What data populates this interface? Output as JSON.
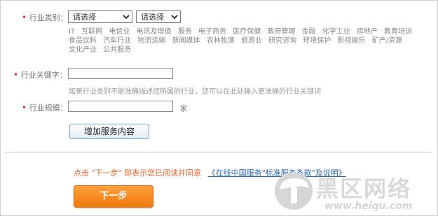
{
  "form": {
    "industry_category": {
      "required_mark": "•",
      "label": "行业类别：",
      "select1_value": "请选择",
      "select2_value": "请选择"
    },
    "industries": [
      "IT",
      "互联网",
      "电信业",
      "电讯及增值",
      "服务",
      "电子商务",
      "医疗保健",
      "政府管理",
      "金融",
      "化学工业",
      "房地产",
      "教育培训",
      "食品饮料",
      "汽车行业",
      "物流运输",
      "新闻媒体",
      "农林牧渔",
      "旅游业",
      "研究咨询",
      "环境保护",
      "影视娱乐",
      "矿产/资源",
      "文化产业",
      "公共服务"
    ],
    "industry_keyword": {
      "required_mark": "•",
      "label": "行业关键字：",
      "value": "",
      "hint": "如果行业类别不能准确描述您所属的行业，您可以在此处输入更准确的行业关键词"
    },
    "industry_scale": {
      "required_mark": "•",
      "label": "行业规模：",
      "value": "",
      "unit": "家"
    },
    "add_service_label": "增加服务内容"
  },
  "footer": {
    "tip_text": "点击 \"下一步\" 即表示您已阅读并同意",
    "tip_link": "《在线中国服务\"标准服务条款\"及说明》",
    "next_label": "下一步"
  },
  "watermark": {
    "name": "黑区网络",
    "url": "www.heiqu.com"
  },
  "colors": {
    "required": "#e0303a",
    "tip": "#e9662a",
    "link": "#2b6cb5",
    "next_button": "#f0780f"
  }
}
